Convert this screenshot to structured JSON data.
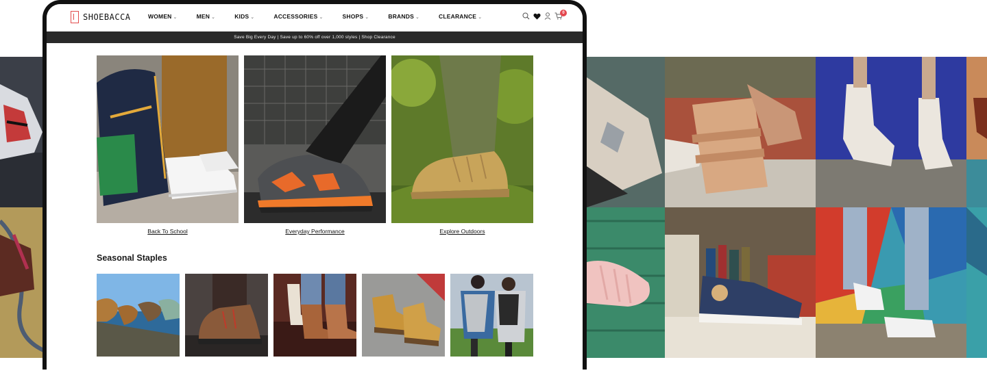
{
  "brand": {
    "name": "SHOEBACCA",
    "accent": "#e24b4b"
  },
  "nav": [
    {
      "label": "WOMEN"
    },
    {
      "label": "MEN"
    },
    {
      "label": "KIDS"
    },
    {
      "label": "ACCESSORIES"
    },
    {
      "label": "SHOPS"
    },
    {
      "label": "BRANDS"
    },
    {
      "label": "CLEARANCE"
    }
  ],
  "header_icons": [
    "search-icon",
    "heart-icon",
    "user-icon",
    "cart-icon"
  ],
  "cart_count": "0",
  "promo": "Save Big Every Day | Save up to 60% off over 1,000 styles | Shop Clearance",
  "featured": [
    {
      "caption": "Back To School"
    },
    {
      "caption": "Everyday Performance"
    },
    {
      "caption": "Explore Outdoors"
    }
  ],
  "seasonal": {
    "title": "Seasonal Staples"
  },
  "colors": {
    "promo_bar": "#2a2a2a",
    "frame": "#111111",
    "badge": "#e4474e"
  }
}
